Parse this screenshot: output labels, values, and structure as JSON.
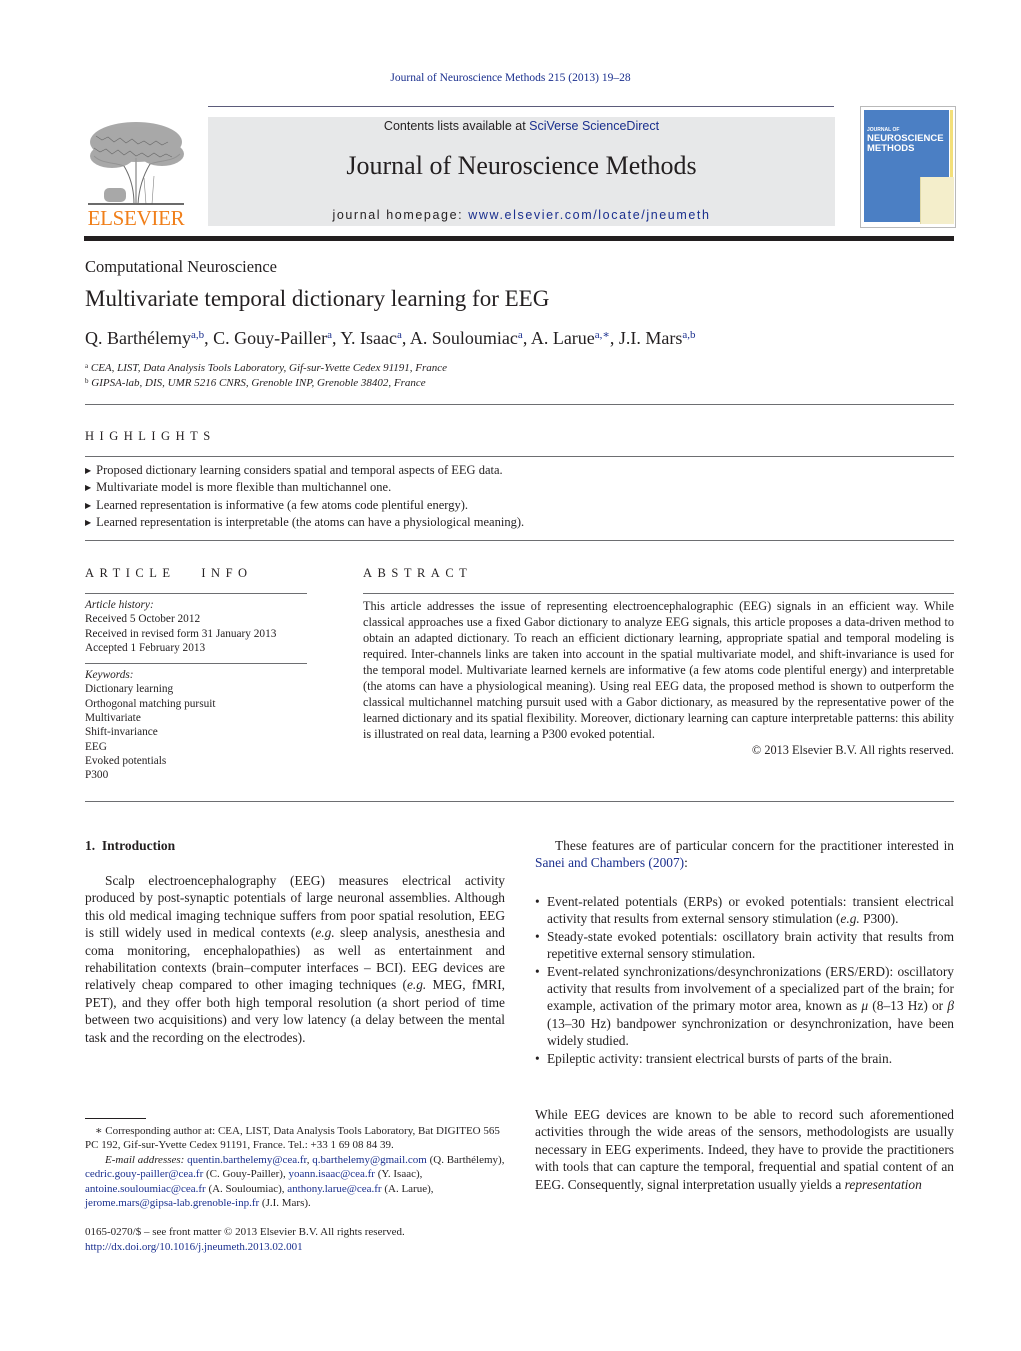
{
  "header": {
    "journal_reference": "Journal of Neuroscience Methods 215 (2013) 19–28",
    "contents_prefix": "Contents lists available at ",
    "contents_link": "SciVerse ScienceDirect",
    "journal_title": "Journal of Neuroscience Methods",
    "homepage_prefix": "journal homepage: ",
    "homepage_link": "www.elsevier.com/locate/jneumeth",
    "publisher_logo_text": "ELSEVIER",
    "cover": {
      "small_title": "JOURNAL OF",
      "title_line1": "NEUROSCIENCE",
      "title_line2": "METHODS"
    },
    "colors": {
      "link": "#1a2f8e",
      "elsevier_orange": "#f07f1a",
      "masthead_bg": "#e7e8e9",
      "cover_blue": "#4b7fc4"
    }
  },
  "article": {
    "section": "Computational Neuroscience",
    "title": "Multivariate temporal dictionary learning for EEG",
    "authors": [
      {
        "name": "Q. Barthélemy",
        "sup": "a,b",
        "sep": ", "
      },
      {
        "name": "C. Gouy-Pailler",
        "sup": "a",
        "sep": ", "
      },
      {
        "name": "Y. Isaac",
        "sup": "a",
        "sep": ", "
      },
      {
        "name": "A. Souloumiac",
        "sup": "a",
        "sep": ", "
      },
      {
        "name": "A. Larue",
        "sup": "a,∗",
        "sep": ", "
      },
      {
        "name": "J.I. Mars",
        "sup": "a,b",
        "sep": ""
      }
    ],
    "affiliations": [
      {
        "mark": "a",
        "text": "CEA, LIST, Data Analysis Tools Laboratory, Gif-sur-Yvette Cedex 91191, France"
      },
      {
        "mark": "b",
        "text": "GIPSA-lab, DIS, UMR 5216 CNRS, Grenoble INP, Grenoble 38402, France"
      }
    ]
  },
  "highlights": {
    "heading": "HIGHLIGHTS",
    "items": [
      "Proposed dictionary learning considers spatial and temporal aspects of EEG data.",
      "Multivariate model is more flexible than multichannel one.",
      "Learned representation is informative (a few atoms code plentiful energy).",
      "Learned representation is interpretable (the atoms can have a physiological meaning)."
    ]
  },
  "article_info": {
    "heading": "ARTICLE   INFO",
    "history_label": "Article history:",
    "history": [
      "Received 5 October 2012",
      "Received in revised form 31 January 2013",
      "Accepted 1 February 2013"
    ],
    "keywords_label": "Keywords:",
    "keywords": [
      "Dictionary learning",
      "Orthogonal matching pursuit",
      "Multivariate",
      "Shift-invariance",
      "EEG",
      "Evoked potentials",
      "P300"
    ]
  },
  "abstract": {
    "heading": "ABSTRACT",
    "text": "This article addresses the issue of representing electroencephalographic (EEG) signals in an efficient way. While classical approaches use a fixed Gabor dictionary to analyze EEG signals, this article proposes a data-driven method to obtain an adapted dictionary. To reach an efficient dictionary learning, appropriate spatial and temporal modeling is required. Inter-channels links are taken into account in the spatial multivariate model, and shift-invariance is used for the temporal model. Multivariate learned kernels are informative (a few atoms code plentiful energy) and interpretable (the atoms can have a physiological meaning). Using real EEG data, the proposed method is shown to outperform the classical multichannel matching pursuit used with a Gabor dictionary, as measured by the representative power of the learned dictionary and its spatial flexibility. Moreover, dictionary learning can capture interpretable patterns: this ability is illustrated on real data, learning a P300 evoked potential.",
    "copyright": "© 2013 Elsevier B.V. All rights reserved."
  },
  "body": {
    "intro_heading": "1.  Introduction",
    "intro_paragraph": [
      {
        "t": "Scalp electroencephalography (EEG) measures electrical activity produced by post-synaptic potentials of large neuronal assemblies. Although this old medical imaging technique suffers from poor spatial resolution, EEG is still widely used in medical contexts ("
      },
      {
        "i": "e.g."
      },
      {
        "t": " sleep analysis, anesthesia and coma monitoring, encephalopathies) as well as entertainment and rehabilitation contexts (brain–computer interfaces – BCI). EEG devices are relatively cheap compared to other imaging techniques ("
      },
      {
        "i": "e.g."
      },
      {
        "t": " MEG, fMRI, PET), and they offer both high temporal resolution (a short period of time between two acquisitions) and very low latency (a delay between the mental task and the recording on the electrodes)."
      }
    ],
    "right_para_1_prefix": "These features are of particular concern for the practitioner interested in ",
    "right_para_1_link": "Sanei and Chambers (2007)",
    "right_para_1_suffix": ":",
    "bullets": [
      [
        {
          "t": "Event-related potentials (ERPs) or evoked potentials: transient electrical activity that results from external sensory stimulation ("
        },
        {
          "i": "e.g."
        },
        {
          "t": " P300)."
        }
      ],
      [
        {
          "t": "Steady-state evoked potentials: oscillatory brain activity that results from repetitive external sensory stimulation."
        }
      ],
      [
        {
          "t": "Event-related synchronizations/desynchronizations (ERS/ERD): oscillatory activity that results from involvement of a specialized part of the brain; for example, activation of the primary motor area, known as "
        },
        {
          "i": "μ"
        },
        {
          "t": " (8–13 Hz) or "
        },
        {
          "i": "β"
        },
        {
          "t": " (13–30 Hz) bandpower synchronization or desynchronization, have been widely studied."
        }
      ],
      [
        {
          "t": "Epileptic activity: transient electrical bursts of parts of the brain."
        }
      ]
    ],
    "right_para_2": [
      {
        "t": "While EEG devices are known to be able to record such aforementioned activities through the wide areas of the sensors, methodologists are usually necessary in EEG experiments. Indeed, they have to provide the practitioners with tools that can capture the temporal, frequential and spatial content of an EEG. Consequently, signal interpretation usually yields a "
      },
      {
        "i": "representation"
      }
    ]
  },
  "footnotes": {
    "corresponding": "∗ Corresponding author at: CEA, LIST, Data Analysis Tools Laboratory, Bat DIGITEO 565 PC 192, Gif-sur-Yvette Cedex 91191, France. Tel.: +33 1 69 08 84 39.",
    "email_label": "E-mail addresses:",
    "emails": [
      {
        "addr": "quentin.barthelemy@cea.fr",
        "who": "",
        "sep": ", "
      },
      {
        "addr": "q.barthelemy@gmail.com",
        "who": " (Q. Barthélemy)",
        "sep": ", "
      },
      {
        "addr": "cedric.gouy-pailler@cea.fr",
        "who": " (C. Gouy-Pailler)",
        "sep": ", "
      },
      {
        "addr": "yoann.isaac@cea.fr",
        "who": " (Y. Isaac)",
        "sep": ", "
      },
      {
        "addr": "antoine.souloumiac@cea.fr",
        "who": " (A. Souloumiac)",
        "sep": ", "
      },
      {
        "addr": "anthony.larue@cea.fr",
        "who": " (A. Larue)",
        "sep": ", "
      },
      {
        "addr": "jerome.mars@gipsa-lab.grenoble-inp.fr",
        "who": " (J.I. Mars).",
        "sep": ""
      }
    ],
    "front_matter": "0165-0270/$ – see front matter © 2013 Elsevier B.V. All rights reserved.",
    "doi": "http://dx.doi.org/10.1016/j.jneumeth.2013.02.001"
  }
}
